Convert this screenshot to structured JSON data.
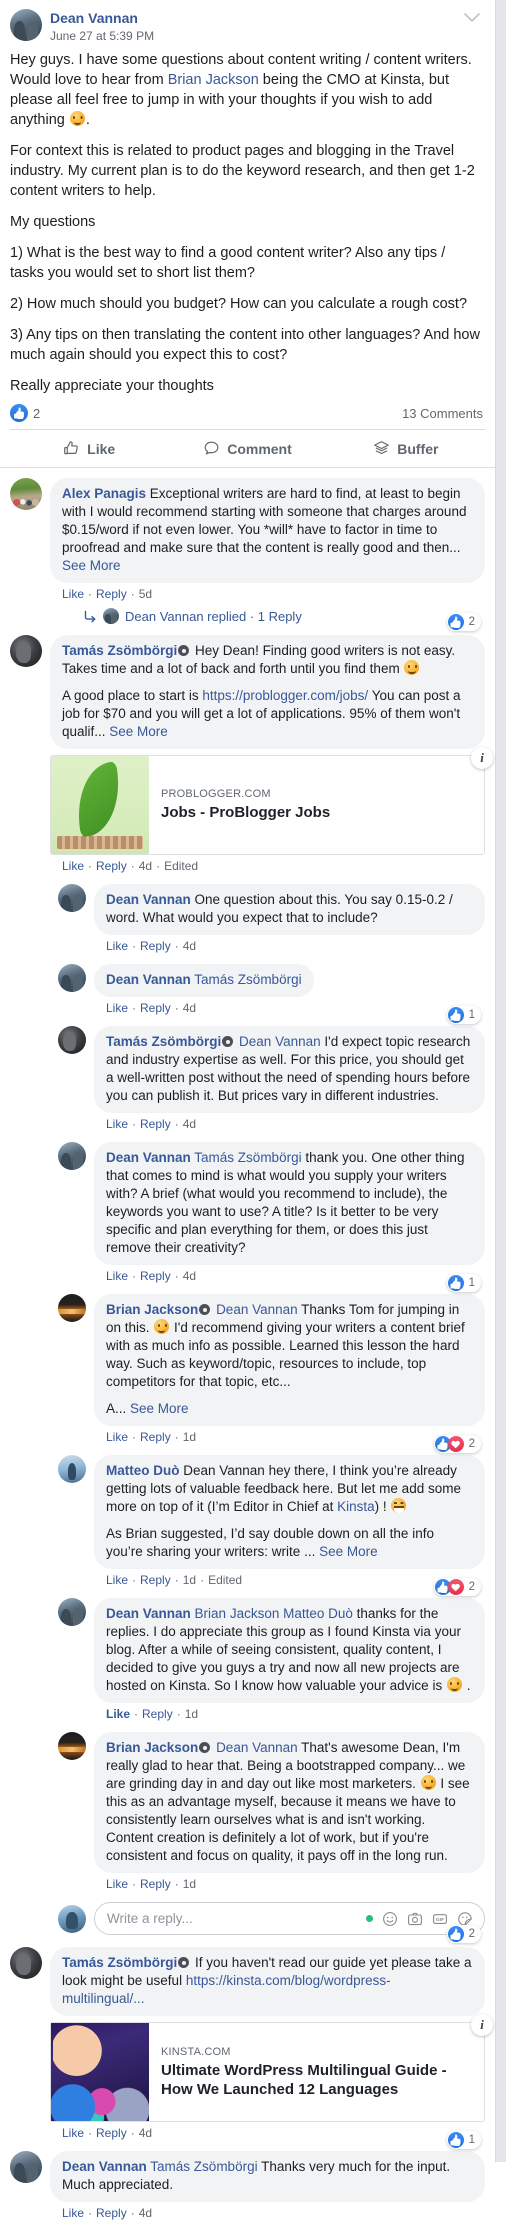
{
  "post": {
    "author": "Dean Vannan",
    "timestamp": "June 27 at 5:39 PM",
    "paragraphs": [
      {
        "segments": [
          {
            "t": "Hey guys. I have some questions about content writing / content writers. Would love to hear from "
          },
          {
            "t": "Brian Jackson",
            "k": "mention"
          },
          {
            "t": " being the CMO at Kinsta, but please all feel free to jump in with your thoughts if you wish to add anything "
          },
          {
            "t": "",
            "k": "emoji-smile"
          },
          {
            "t": "."
          }
        ]
      },
      {
        "segments": [
          {
            "t": "For context this is related to product pages and blogging in the Travel industry. My current plan is to do the keyword research, and then get 1-2 content writers to help."
          }
        ]
      },
      {
        "segments": [
          {
            "t": "My questions"
          }
        ]
      },
      {
        "segments": [
          {
            "t": "1) What is the best way to find a good content writer? Also any tips / tasks you would set to short list them?"
          }
        ]
      },
      {
        "segments": [
          {
            "t": "2) How much should you budget? How can you calculate a rough cost?"
          }
        ]
      },
      {
        "segments": [
          {
            "t": "3) Any tips on then translating the content into other languages? And how much again should you expect this to cost?"
          }
        ]
      },
      {
        "segments": [
          {
            "t": "Really appreciate your thoughts"
          }
        ]
      }
    ],
    "reaction_count": "2",
    "comments_count": "13 Comments"
  },
  "actions": [
    {
      "label": "Like",
      "icon": "thumbs-up-icon"
    },
    {
      "label": "Comment",
      "icon": "speech-bubble-icon"
    },
    {
      "label": "Buffer",
      "icon": "buffer-stack-icon"
    }
  ],
  "meta_labels": {
    "like": "Like",
    "reply": "Reply",
    "edited": "Edited",
    "see_more": "See More"
  },
  "composer": {
    "placeholder": "Write a reply...",
    "icons": [
      "status-dot-icon",
      "emoji-icon",
      "camera-icon",
      "gif-icon",
      "sticker-icon"
    ]
  },
  "comments": [
    {
      "id": "c1",
      "level": 1,
      "avatar": "av-alex",
      "author": "Alex Panagis",
      "verified": false,
      "paragraphs": [
        {
          "segments": [
            {
              "t": "Alex Panagis",
              "k": "name"
            },
            {
              "t": " Exceptional writers are hard to find, at least to begin with I would recommend starting with someone that charges around $0.15/word if not even lower. You *will* have to factor in time to proofread and make sure that the content is really good and then... "
            },
            {
              "t": "See More",
              "k": "seemore"
            }
          ]
        }
      ],
      "time": "5d",
      "edited": false,
      "reactions": null,
      "replied_row": {
        "text": "Dean Vannan replied · 1 Reply",
        "avatar": "av-dean"
      }
    },
    {
      "id": "c2",
      "level": 1,
      "avatar": "av-tamas",
      "author": "Tamás Zsömbörgi",
      "verified": true,
      "paragraphs": [
        {
          "segments": [
            {
              "t": "Tamás Zsömbörgi",
              "k": "name"
            },
            {
              "t": "",
              "k": "verified"
            },
            {
              "t": " Hey Dean! Finding good writers is not easy. Takes time and a lot of back and forth until you find them "
            },
            {
              "t": "",
              "k": "emoji-smile"
            }
          ]
        },
        {
          "segments": [
            {
              "t": "A good place to start is "
            },
            {
              "t": "https://problogger.com/jobs/",
              "k": "link"
            },
            {
              "t": " You can post a job for $70 and you will get a lot of applications. 95% of them won't qualif... "
            },
            {
              "t": "See More",
              "k": "seemore"
            }
          ]
        }
      ],
      "link_preview": {
        "thumb": "lp-thumb-problogger",
        "domain": "PROBLOGGER.COM",
        "title": "Jobs - ProBlogger Jobs",
        "info_glyph": "i"
      },
      "time": "4d",
      "edited": true,
      "reactions": {
        "types": [
          "like"
        ],
        "count": "2",
        "top": "-22"
      }
    },
    {
      "id": "c3",
      "level": 2,
      "avatar": "av-dean",
      "author": "Dean Vannan",
      "verified": false,
      "paragraphs": [
        {
          "segments": [
            {
              "t": "Dean Vannan",
              "k": "name"
            },
            {
              "t": " One question about this. You say 0.15-0.2 / word. What would you expect that to include?"
            }
          ]
        }
      ],
      "time": "4d",
      "edited": false,
      "reactions": null
    },
    {
      "id": "c4",
      "level": 2,
      "avatar": "av-dean",
      "author": "Dean Vannan",
      "verified": false,
      "paragraphs": [
        {
          "segments": [
            {
              "t": "Dean Vannan",
              "k": "name"
            },
            {
              "t": " "
            },
            {
              "t": "Tamás Zsömbörgi",
              "k": "nameplain"
            }
          ]
        }
      ],
      "time": "4d",
      "edited": false,
      "reactions": null
    },
    {
      "id": "c5",
      "level": 2,
      "avatar": "av-tamas",
      "author": "Tamás Zsömbörgi",
      "verified": true,
      "paragraphs": [
        {
          "segments": [
            {
              "t": "Tamás Zsömbörgi",
              "k": "name"
            },
            {
              "t": "",
              "k": "verified"
            },
            {
              "t": " "
            },
            {
              "t": "Dean Vannan",
              "k": "nameplain"
            },
            {
              "t": " I'd expect topic research and industry expertise as well. For this price, you should get a well-written post without the need of spending hours before you can publish it. But prices vary in different industries."
            }
          ]
        }
      ],
      "time": "4d",
      "edited": false,
      "reactions": {
        "types": [
          "like"
        ],
        "count": "1",
        "top": "-20"
      }
    },
    {
      "id": "c6",
      "level": 2,
      "avatar": "av-dean",
      "author": "Dean Vannan",
      "verified": false,
      "paragraphs": [
        {
          "segments": [
            {
              "t": "Dean Vannan",
              "k": "name"
            },
            {
              "t": " "
            },
            {
              "t": "Tamás Zsömbörgi",
              "k": "nameplain"
            },
            {
              "t": " thank you. One other thing that comes to mind is what would you supply your writers with? A brief (what would you recommend to include), the keywords you want to use? A title? Is it better to be very specific and plan everything for them, or does this just remove their creativity?"
            }
          ]
        }
      ],
      "time": "4d",
      "edited": false,
      "reactions": null
    },
    {
      "id": "c7",
      "level": 2,
      "avatar": "av-brian",
      "author": "Brian Jackson",
      "verified": true,
      "paragraphs": [
        {
          "segments": [
            {
              "t": "Brian Jackson",
              "k": "name"
            },
            {
              "t": "",
              "k": "verified"
            },
            {
              "t": " "
            },
            {
              "t": "Dean Vannan",
              "k": "nameplain"
            },
            {
              "t": " Thanks Tom for jumping in on this. "
            },
            {
              "t": "",
              "k": "emoji-smile"
            },
            {
              "t": " I'd recommend giving your writers a content brief with as much info as possible. Learned this lesson the hard way. Such as keyword/topic, resources to include, top competitors for that topic, etc..."
            }
          ]
        },
        {
          "segments": [
            {
              "t": "A... "
            },
            {
              "t": "See More",
              "k": "seemore"
            }
          ]
        }
      ],
      "time": "1d",
      "edited": false,
      "reactions": {
        "types": [
          "like"
        ],
        "count": "1",
        "top": "-20"
      }
    },
    {
      "id": "c8",
      "level": 2,
      "avatar": "av-matteo",
      "author": "Matteo Duò",
      "verified": false,
      "paragraphs": [
        {
          "segments": [
            {
              "t": "Matteo Duò",
              "k": "name"
            },
            {
              "t": " Dean Vannan hey there, I think you’re already getting lots of valuable feedback here. But let me add some more on top of it (I’m Editor in Chief at "
            },
            {
              "t": "Kinsta",
              "k": "link"
            },
            {
              "t": ") ! "
            },
            {
              "t": "",
              "k": "emoji-grin"
            }
          ]
        },
        {
          "segments": [
            {
              "t": "As Brian suggested, I’d say double down on all the info you’re sharing your writers: write ... "
            },
            {
              "t": "See More",
              "k": "seemore"
            }
          ]
        }
      ],
      "time": "1d",
      "edited": true,
      "reactions": {
        "types": [
          "like",
          "love"
        ],
        "count": "2",
        "top": "-20"
      }
    },
    {
      "id": "c9",
      "level": 2,
      "avatar": "av-dean",
      "author": "Dean Vannan",
      "verified": false,
      "paragraphs": [
        {
          "segments": [
            {
              "t": "Dean Vannan",
              "k": "name"
            },
            {
              "t": " "
            },
            {
              "t": "Brian Jackson Matteo Duò",
              "k": "nameplain"
            },
            {
              "t": " thanks for the replies. I do appreciate this group as I found Kinsta via your blog. After a while of seeing consistent, quality content, I decided to give you guys a try and now all new projects are hosted on Kinsta. So I know how valuable your advice is "
            },
            {
              "t": "",
              "k": "emoji-smile"
            },
            {
              "t": " ."
            }
          ]
        }
      ],
      "time": "1d",
      "edited": false,
      "like_bold": true,
      "reactions": {
        "types": [
          "like",
          "love"
        ],
        "count": "2",
        "top": "-20"
      }
    },
    {
      "id": "c10",
      "level": 2,
      "avatar": "av-brian",
      "author": "Brian Jackson",
      "verified": true,
      "paragraphs": [
        {
          "segments": [
            {
              "t": "Brian Jackson",
              "k": "name"
            },
            {
              "t": "",
              "k": "verified"
            },
            {
              "t": " "
            },
            {
              "t": "Dean Vannan",
              "k": "nameplain"
            },
            {
              "t": " That's awesome Dean, I'm really glad to hear that. Being a bootstrapped company... we are grinding day in and day out like most marketers. "
            },
            {
              "t": "",
              "k": "emoji-smile"
            },
            {
              "t": " I see this as an advantage myself, because it means we have to consistently learn ourselves what is and isn't working. Content creation is definitely a lot of work, but if you're consistent and focus on quality, it pays off in the long run."
            }
          ]
        }
      ],
      "time": "1d",
      "edited": false,
      "reactions": null
    },
    {
      "id": "c11",
      "level": 1,
      "avatar": "av-tamas",
      "author": "Tamás Zsömbörgi",
      "verified": true,
      "paragraphs": [
        {
          "segments": [
            {
              "t": "Tamás Zsömbörgi",
              "k": "name"
            },
            {
              "t": "",
              "k": "verified"
            },
            {
              "t": " If you haven't read our guide yet please take a look might be useful "
            },
            {
              "t": "https://kinsta.com/blog/wordpress-multilingual/...",
              "k": "link"
            }
          ]
        }
      ],
      "link_preview": {
        "thumb": "lp-thumb-kinsta",
        "domain": "KINSTA.COM",
        "title": "Ultimate WordPress Multilingual Guide - How We Launched 12 Languages",
        "info_glyph": "i"
      },
      "time": "4d",
      "edited": false,
      "reactions": {
        "types": [
          "like"
        ],
        "count": "2",
        "top": "-22"
      }
    },
    {
      "id": "c12",
      "level": 1,
      "avatar": "av-dean",
      "author": "Dean Vannan",
      "verified": false,
      "paragraphs": [
        {
          "segments": [
            {
              "t": "Dean Vannan",
              "k": "name"
            },
            {
              "t": " "
            },
            {
              "t": "Tamás Zsömbörgi",
              "k": "nameplain"
            },
            {
              "t": " Thanks very much for the input. Much appreciated."
            }
          ]
        }
      ],
      "time": "4d",
      "edited": false,
      "reactions": {
        "types": [
          "like"
        ],
        "count": "1",
        "top": "-20"
      }
    }
  ]
}
